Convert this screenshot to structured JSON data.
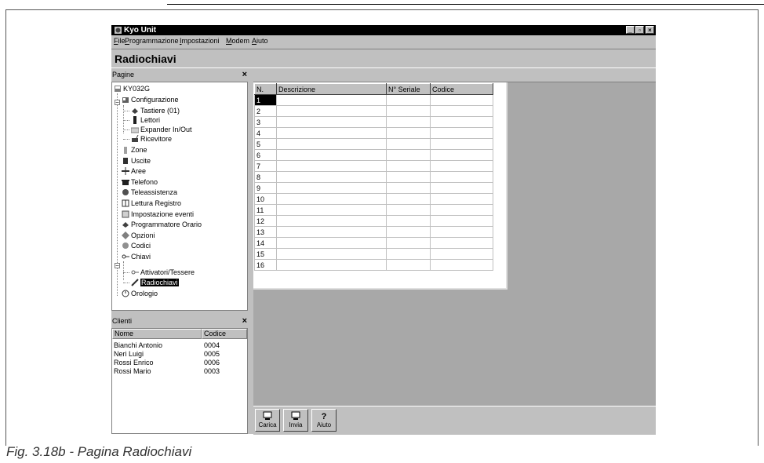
{
  "window": {
    "title": "Kyo Unit",
    "minimize": "_",
    "maximize": "▫",
    "close": "×"
  },
  "menu": [
    "File",
    "Programmazione",
    "Impostazioni",
    "Modem",
    "Aiuto"
  ],
  "page_title": "Radiochiavi",
  "pages_panel": {
    "title": "Pagine",
    "close": "×",
    "tree": {
      "root": "KY032G",
      "configurazione": "Configurazione",
      "tastiere": "Tastiere (01)",
      "lettori": "Lettori",
      "expander": "Expander In/Out",
      "ricevitore": "Ricevitore",
      "zone": "Zone",
      "uscite": "Uscite",
      "aree": "Aree",
      "telefono": "Telefono",
      "teleassistenza": "Teleassistenza",
      "lettura_registro": "Lettura Registro",
      "impostazione_eventi": "Impostazione eventi",
      "programmatore_orario": "Programmatore Orario",
      "opzioni": "Opzioni",
      "codici": "Codici",
      "chiavi": "Chiavi",
      "attivatori": "Attivatori/Tessere",
      "radiochiavi": "Radiochiavi",
      "orologio": "Orologio"
    }
  },
  "clients_panel": {
    "title": "Clienti",
    "close": "×",
    "columns": [
      "Nome",
      "Codice"
    ],
    "rows": [
      [
        "Bianchi Antonio",
        "0004"
      ],
      [
        "Neri Luigi",
        "0005"
      ],
      [
        "Rossi Enrico",
        "0006"
      ],
      [
        "Rossi Mario",
        "0003"
      ]
    ]
  },
  "grid": {
    "columns": [
      "N.",
      "Descrizione",
      "N° Seriale",
      "Codice"
    ],
    "rows": [
      "1",
      "2",
      "3",
      "4",
      "5",
      "6",
      "7",
      "8",
      "9",
      "10",
      "11",
      "12",
      "13",
      "14",
      "15",
      "16"
    ]
  },
  "toolbar": {
    "carica": "Carica",
    "invia": "Invia",
    "aiuto": "Aiuto"
  },
  "caption": "Fig. 3.18b - Pagina Radiochiavi"
}
